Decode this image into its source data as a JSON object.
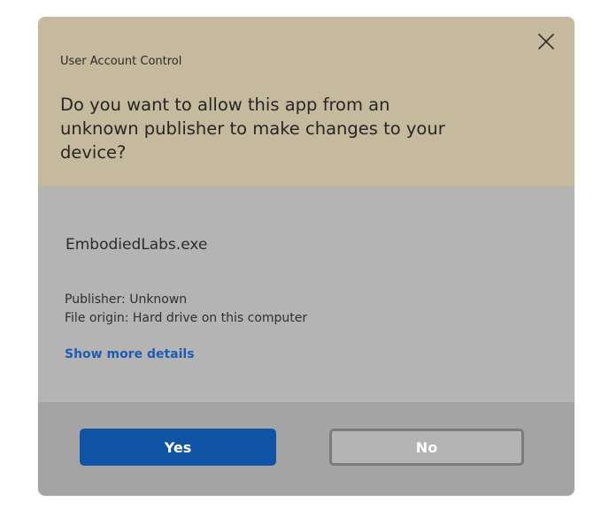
{
  "dialog": {
    "window_title": "User Account Control",
    "question": "Do you want to allow this app from an unknown publisher to make changes to your device?",
    "close_icon": "close-icon",
    "app_name": "EmbodiedLabs.exe",
    "publisher": "Publisher: Unknown",
    "file_origin": "File origin: Hard drive on this computer",
    "details_link": "Show more details",
    "yes_label": "Yes",
    "no_label": "No"
  },
  "colors": {
    "header": "#c5b99e",
    "body": "#b4b4b4",
    "footer": "#a4a4a4",
    "accent": "#0f53a5",
    "link": "#1f5bb0"
  }
}
